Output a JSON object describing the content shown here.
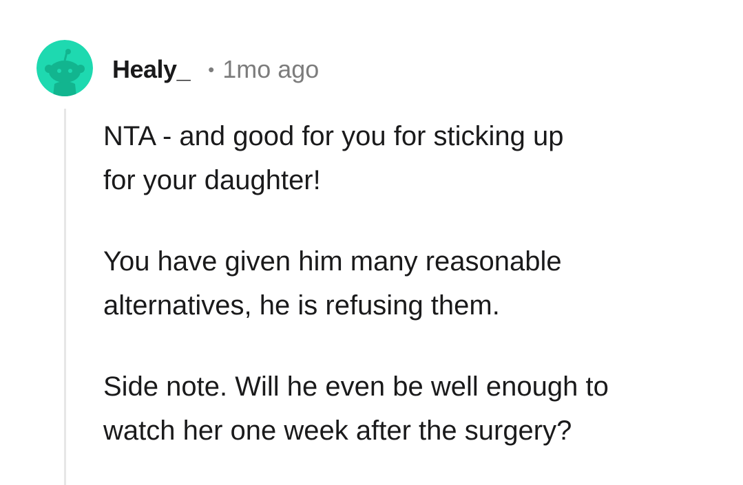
{
  "comment": {
    "author": "Healy_",
    "separator": "•",
    "timestamp": "1mo ago",
    "avatar_icon": "reddit-snoo-avatar",
    "avatar_color": "#1ed9b0",
    "paragraphs": [
      {
        "lines": [
          "NTA - and good for you for sticking up",
          "for your daughter!"
        ]
      },
      {
        "lines": [
          "You have given him many reasonable",
          "alternatives, he is refusing them."
        ]
      },
      {
        "lines": [
          "Side note. Will he even be well enough to",
          "watch her one week after the surgery?"
        ]
      }
    ]
  }
}
